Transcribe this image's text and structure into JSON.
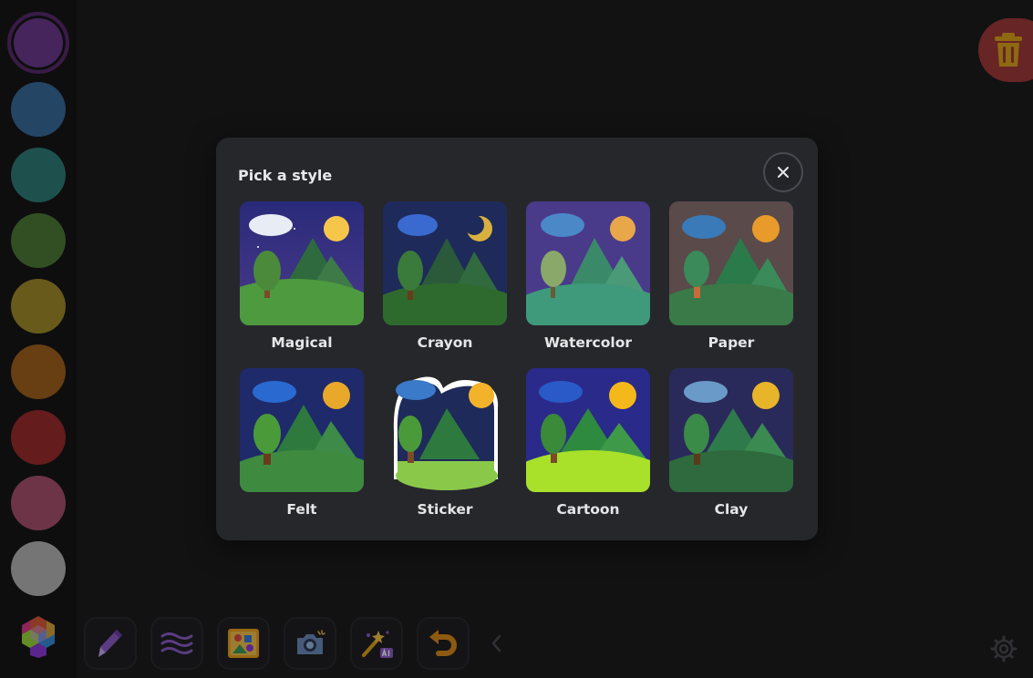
{
  "dialog": {
    "title": "Pick a style",
    "styles": [
      {
        "label": "Magical"
      },
      {
        "label": "Crayon"
      },
      {
        "label": "Watercolor"
      },
      {
        "label": "Paper"
      },
      {
        "label": "Felt"
      },
      {
        "label": "Sticker"
      },
      {
        "label": "Cartoon"
      },
      {
        "label": "Clay"
      }
    ]
  },
  "palette": {
    "colors": [
      "#6b3a8c",
      "#3a6a9a",
      "#2e7d78",
      "#4e7a38",
      "#a08a28",
      "#a0601e",
      "#9a2c2c",
      "#a8506e",
      "#b4b4b4"
    ],
    "selected_index": 0
  },
  "toolbar": {
    "tools": [
      "pen-icon",
      "waves-icon",
      "image-icon",
      "camera-icon",
      "ai-magic-wand-icon",
      "undo-icon"
    ]
  },
  "icons": {
    "trash": "trash-icon",
    "close": "close-icon",
    "settings": "gear-icon",
    "collapse": "chevron-left-icon",
    "color_wheel": "color-wheel-icon"
  },
  "colors": {
    "background": "#1c1c1e",
    "dialog": "#26272b",
    "trash": "#9e3a3a",
    "trash_icon": "#d9a21b",
    "pen": "#8a5cc6",
    "undo": "#d98a1b"
  }
}
